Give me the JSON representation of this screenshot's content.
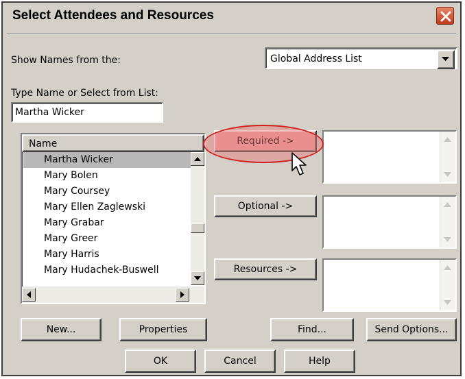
{
  "window": {
    "title": "Select Attendees and Resources",
    "close_icon": "close-icon"
  },
  "source": {
    "label": "Show Names from the:",
    "selected": "Global Address List"
  },
  "search": {
    "label": "Type Name or Select from List:",
    "value": "Martha Wicker"
  },
  "names_list": {
    "column_header": "Name",
    "items": [
      "Martha Wicker",
      "Mary Bolen",
      "Mary Coursey",
      "Mary Ellen Zaglewski",
      "Mary Grabar",
      "Mary Greer",
      "Mary Harris",
      "Mary Hudachek-Buswell"
    ],
    "selected_index": 0
  },
  "recipients": {
    "required_label": "Required ->",
    "optional_label": "Optional ->",
    "resources_label": "Resources ->"
  },
  "bottom_row": {
    "new_label": "New...",
    "properties_label": "Properties",
    "find_label": "Find...",
    "send_options_label": "Send Options..."
  },
  "footer": {
    "ok_label": "OK",
    "cancel_label": "Cancel",
    "help_label": "Help"
  },
  "colors": {
    "dialog_face": "#d4d0c8",
    "highlight_oval": "#d02020",
    "close_button": "#c0391b"
  }
}
